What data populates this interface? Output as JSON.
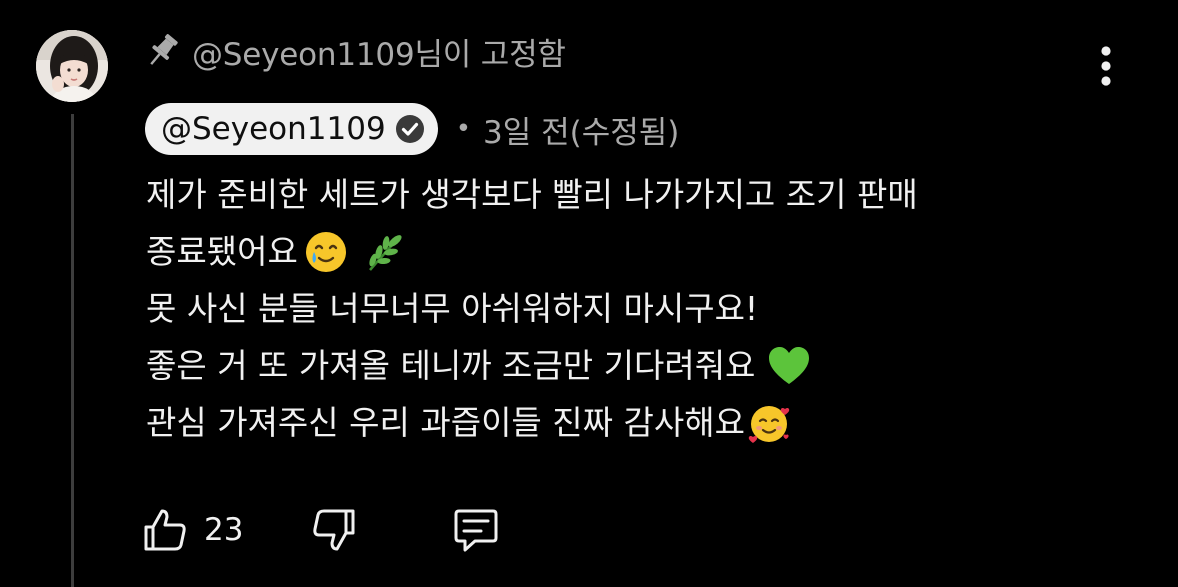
{
  "comment": {
    "pinned_text": "@Seyeon1109님이 고정함",
    "author": "@Seyeon1109",
    "time": "3일 전(수정됨)",
    "lines": [
      "제가 준비한 세트가 생각보다 빨리 나가가지고 조기 판매",
      "종료됐어요",
      "못 사신 분들 너무너무 아쉬워하지 마시구요!",
      "좋은 거 또 가져올 테니까 조금만 기다려줘요",
      "관심 가져주신 우리 과즙이들 진짜 감사해요"
    ],
    "like_count": "23"
  },
  "icons": {
    "pin": "pin-icon",
    "verified": "verified-check-icon",
    "more": "more-vertical-icon",
    "like": "thumbs-up-icon",
    "dislike": "thumbs-down-icon",
    "reply": "reply-comment-icon",
    "emoji_tear": "smiling-face-with-tear-emoji",
    "emoji_herb": "herb-emoji",
    "emoji_heart": "green-heart-emoji",
    "emoji_hearts": "smiling-face-with-hearts-emoji"
  },
  "colors": {
    "background": "#000000",
    "text": "#f1f1f1",
    "secondary_text": "#aaaaaa",
    "chip_background": "#f1f1f1",
    "thread_line": "#3d3d3d"
  }
}
